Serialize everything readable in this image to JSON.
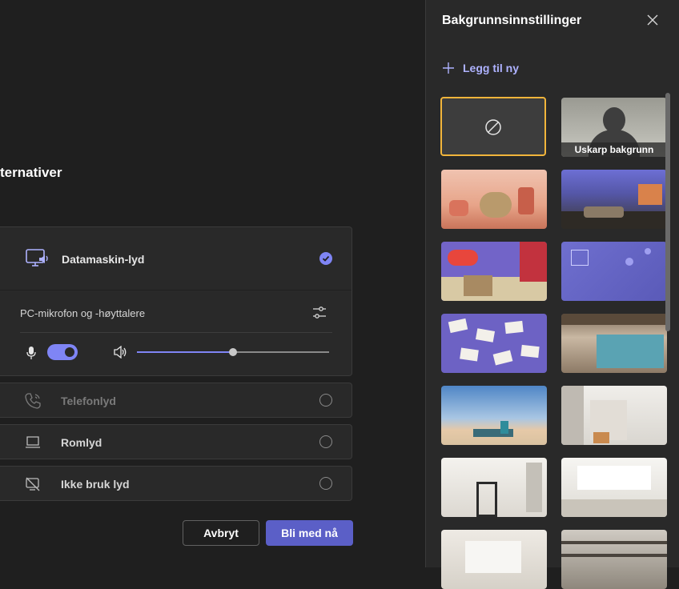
{
  "left": {
    "section_title": "ternativer",
    "computer_audio": {
      "label": "Datamaskin-lyd",
      "device_label": "PC-mikrofon og -høyttalere",
      "volume_fraction": 0.5,
      "mic_on": true
    },
    "options": [
      {
        "label": "Telefonlyd",
        "icon": "phone-icon",
        "disabled": true
      },
      {
        "label": "Romlyd",
        "icon": "room-display-icon",
        "disabled": false
      },
      {
        "label": "Ikke bruk lyd",
        "icon": "no-audio-icon",
        "disabled": false
      }
    ],
    "buttons": {
      "cancel": "Avbryt",
      "join": "Bli med nå"
    }
  },
  "panel": {
    "title": "Bakgrunnsinnstillinger",
    "add_new": "Legg til ny",
    "blur_caption": "Uskarp bakgrunn"
  },
  "colors": {
    "accent": "#7f85f5",
    "join_button": "#5b5fc7",
    "selected_border": "#f2b53b"
  }
}
